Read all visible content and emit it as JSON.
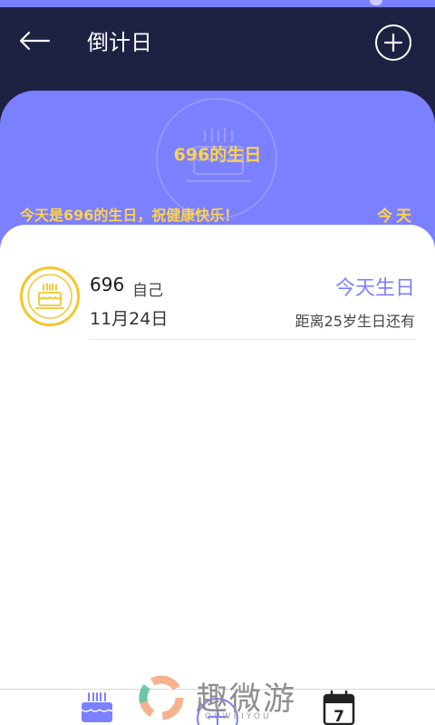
{
  "header": {
    "title": "倒计日",
    "back_icon": "back-arrow-icon",
    "add_icon": "plus-circle-icon"
  },
  "hero": {
    "title": "696的生日",
    "message": "今天是696的生日，祝健康快乐！",
    "today": "今天",
    "icon": "birthday-cake-icon"
  },
  "entries": [
    {
      "name": "696",
      "relation": "自己",
      "date": "11月24日",
      "countdown": "今天生日",
      "subtitle": "距离25岁生日还有",
      "icon": "birthday-cake-icon"
    }
  ],
  "tabs": [
    {
      "icon": "birthday-cake-icon"
    },
    {
      "icon": "add-icon"
    },
    {
      "icon": "calendar-icon",
      "label": "7"
    }
  ],
  "watermark": {
    "text": "趣微游",
    "subtext": "QUWEIYOU"
  },
  "colors": {
    "header_bg": "#1d2142",
    "accent": "#7b80ff",
    "highlight": "#ffd24a",
    "badge": "#f4c62b"
  }
}
